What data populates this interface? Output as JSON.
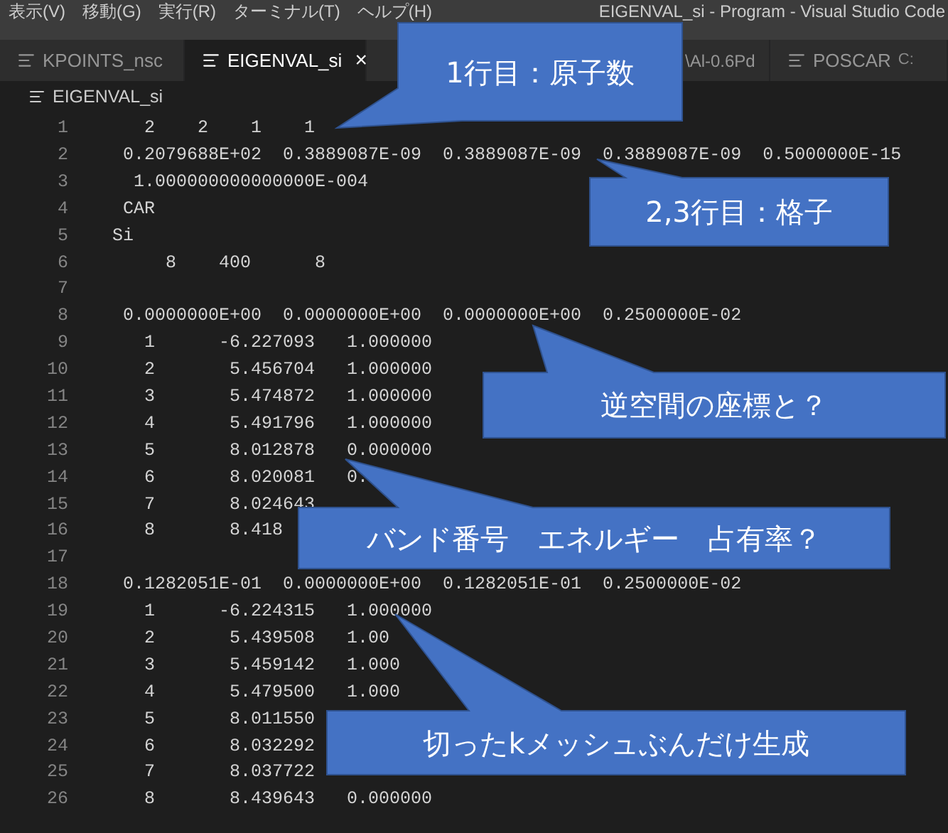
{
  "menu": [
    "表示(V)",
    "移動(G)",
    "実行(R)",
    "ターミナル(T)",
    "ヘルプ(H)"
  ],
  "window": {
    "title": "EIGENVAL_si - Program - Visual Studio Code"
  },
  "tabs": [
    {
      "label": "KPOINTS_nsc",
      "selected": false
    },
    {
      "label": "EIGENVAL_si",
      "selected": true,
      "close": "×"
    },
    {
      "label": "\\Al-0.6Pd",
      "selected": false
    },
    {
      "label": "POSCAR",
      "description": "C:",
      "selected": false
    }
  ],
  "breadcrumb": "EIGENVAL_si",
  "lines": [
    {
      "n": "1",
      "text": "   2    2    1    1"
    },
    {
      "n": "2",
      "text": " 0.2079688E+02  0.3889087E-09  0.3889087E-09  0.3889087E-09  0.5000000E-15"
    },
    {
      "n": "3",
      "text": "  1.000000000000000E-004"
    },
    {
      "n": "4",
      "text": " CAR"
    },
    {
      "n": "5",
      "text": "Si"
    },
    {
      "n": "6",
      "text": "     8    400      8"
    },
    {
      "n": "7"
    },
    {
      "n": "8",
      "text": " 0.0000000E+00  0.0000000E+00  0.0000000E+00  0.2500000E-02"
    },
    {
      "n": "9",
      "text": "   1      -6.227093   1.000000"
    },
    {
      "n": "10",
      "text": "   2       5.456704   1.000000"
    },
    {
      "n": "11",
      "text": "   3       5.474872   1.000000"
    },
    {
      "n": "12",
      "text": "   4       5.491796   1.000000"
    },
    {
      "n": "13",
      "text": "   5       8.012878   0.000000"
    },
    {
      "n": "14",
      "text": "   6       8.020081   0."
    },
    {
      "n": "15",
      "text": "   7       8.024643"
    },
    {
      "n": "16",
      "text": "   8       8.418"
    },
    {
      "n": "17"
    },
    {
      "n": "18",
      "text": " 0.1282051E-01  0.0000000E+00  0.1282051E-01  0.2500000E-02"
    },
    {
      "n": "19",
      "text": "   1      -6.224315   1.000000"
    },
    {
      "n": "20",
      "text": "   2       5.439508   1.00"
    },
    {
      "n": "21",
      "text": "   3       5.459142   1.000"
    },
    {
      "n": "22",
      "text": "   4       5.479500   1.000"
    },
    {
      "n": "23",
      "text": "   5       8.011550"
    },
    {
      "n": "24",
      "text": "   6       8.032292"
    },
    {
      "n": "25",
      "text": "   7       8.037722"
    },
    {
      "n": "26",
      "text": "   8       8.439643   0.000000"
    }
  ],
  "callouts": [
    {
      "text": "1行目：原子数"
    },
    {
      "text": "2,3行目：格子"
    },
    {
      "text": "逆空間の座標と？"
    },
    {
      "text": "バンド番号　エネルギー　占有率？"
    },
    {
      "text": "切ったkメッシュぶんだけ生成"
    }
  ]
}
